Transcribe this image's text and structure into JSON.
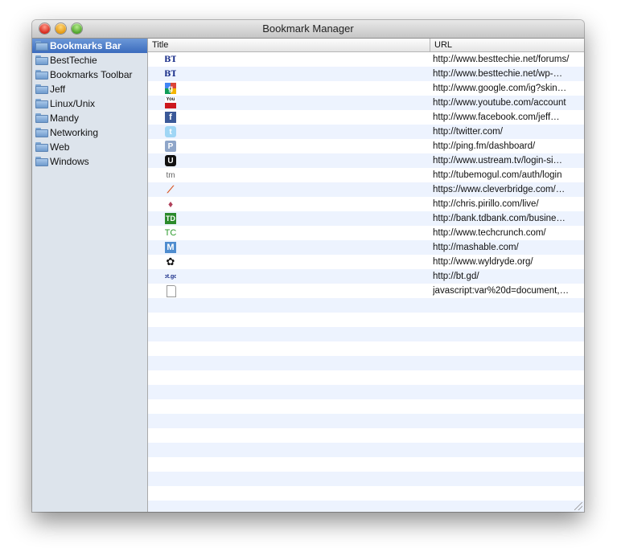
{
  "window": {
    "title": "Bookmark Manager"
  },
  "sidebar": {
    "items": [
      {
        "label": "Bookmarks Bar",
        "selected": true
      },
      {
        "label": "BestTechie"
      },
      {
        "label": "Bookmarks Toolbar"
      },
      {
        "label": "Jeff"
      },
      {
        "label": "Linux/Unix"
      },
      {
        "label": "Mandy"
      },
      {
        "label": "Networking"
      },
      {
        "label": "Web"
      },
      {
        "label": "Windows"
      }
    ]
  },
  "table": {
    "columns": {
      "title": "Title",
      "url": "URL"
    },
    "rows": [
      {
        "icon": "besttechie-icon",
        "glyph": "BT",
        "url": "http://www.besttechie.net/forums/"
      },
      {
        "icon": "besttechie-icon",
        "glyph": "BT",
        "url": "http://www.besttechie.net/wp-…"
      },
      {
        "icon": "google-icon",
        "glyph": "g",
        "url": "http://www.google.com/ig?skin…"
      },
      {
        "icon": "youtube-icon",
        "glyph": "You",
        "url": "http://www.youtube.com/account"
      },
      {
        "icon": "facebook-icon",
        "glyph": "f",
        "url": "http://www.facebook.com/jeff…"
      },
      {
        "icon": "twitter-icon",
        "glyph": "t",
        "url": "http://twitter.com/"
      },
      {
        "icon": "pingfm-icon",
        "glyph": "P",
        "url": "http://ping.fm/dashboard/"
      },
      {
        "icon": "ustream-icon",
        "glyph": "U",
        "url": "http://www.ustream.tv/login-si…"
      },
      {
        "icon": "tubemogul-icon",
        "glyph": "tm",
        "url": "http://tubemogul.com/auth/login"
      },
      {
        "icon": "cleverbridge-icon",
        "glyph": "⟋",
        "url": "https://www.cleverbridge.com/…"
      },
      {
        "icon": "chrispirillo-icon",
        "glyph": "♦",
        "url": "http://chris.pirillo.com/live/"
      },
      {
        "icon": "tdbank-icon",
        "glyph": "TD",
        "url": "http://bank.tdbank.com/busine…"
      },
      {
        "icon": "techcrunch-icon",
        "glyph": "TC",
        "url": "http://www.techcrunch.com/"
      },
      {
        "icon": "mashable-icon",
        "glyph": "M",
        "url": "http://mashable.com/"
      },
      {
        "icon": "wyldryde-icon",
        "glyph": "✿",
        "url": "http://www.wyldryde.org/"
      },
      {
        "icon": "btgd-icon",
        "glyph": "bt.gd",
        "url": "http://bt.gd/"
      },
      {
        "icon": "document-icon",
        "glyph": "",
        "url": "javascript:var%20d=document,…"
      }
    ]
  },
  "colors": {
    "sidebar_bg": "#dde4ec",
    "selection": "#3a6bbd",
    "stripe": "#edf3fe"
  }
}
